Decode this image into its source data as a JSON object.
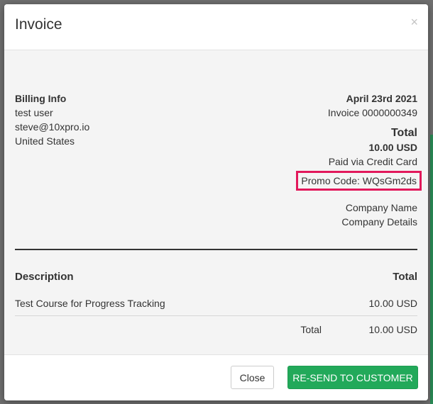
{
  "modal": {
    "title": "Invoice"
  },
  "billing": {
    "heading": "Billing Info",
    "name": "test user",
    "email": "steve@10xpro.io",
    "country": "United States"
  },
  "invoice": {
    "date": "April 23rd 2021",
    "number": "Invoice 0000000349",
    "total_heading": "Total",
    "total_amount": "10.00 USD",
    "payment_method": "Paid via Credit Card",
    "promo": "Promo Code: WQsGm2ds",
    "company_name": "Company Name",
    "company_details": "Company Details"
  },
  "table": {
    "headers": {
      "description": "Description",
      "total": "Total"
    },
    "rows": [
      {
        "description": "Test Course for Progress Tracking",
        "amount": "10.00 USD"
      }
    ],
    "summary": {
      "label": "Total",
      "value": "10.00 USD"
    }
  },
  "footer": {
    "close_label": "Close",
    "resend_label": "RE-SEND TO CUSTOMER"
  },
  "colors": {
    "accent_green": "#22a95a",
    "highlight_pink": "#e2185b"
  }
}
